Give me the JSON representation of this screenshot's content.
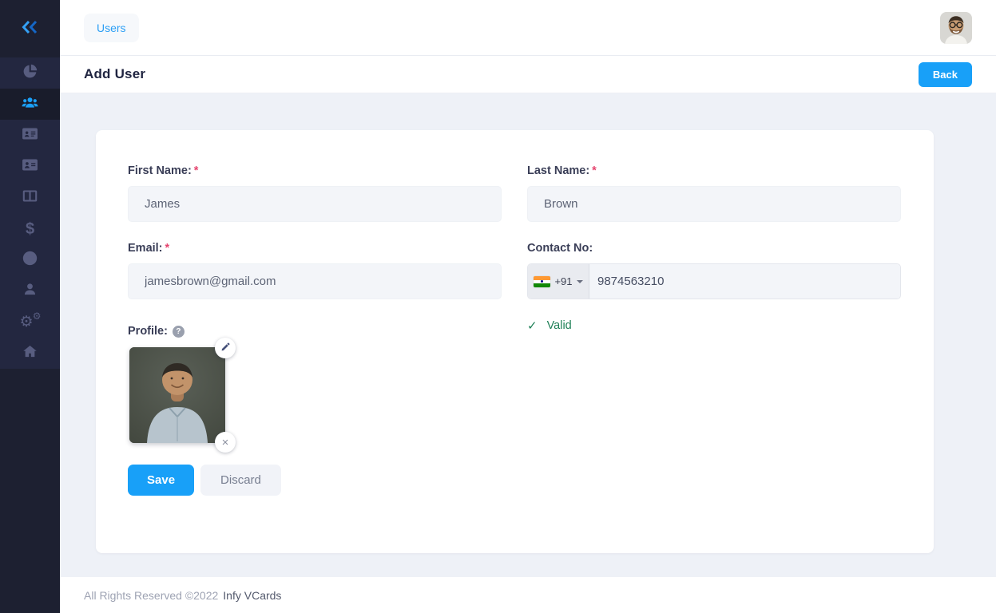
{
  "colors": {
    "accent_blue": "#18a0f8",
    "sidebar_bg": "#1d2031",
    "sidebar_icon": "#585d80",
    "valid_green": "#1f8057",
    "required_red": "#e5456f",
    "content_bg": "#eef1f7"
  },
  "glyphs": {
    "dollar": "$",
    "gear": "⚙",
    "close": "×",
    "question": "?",
    "check": "✓"
  },
  "sidebar": {
    "collapse_icon": "double-chevron-left",
    "items": [
      {
        "icon": "pie-chart",
        "name": "dashboard",
        "active": false
      },
      {
        "icon": "users-group",
        "name": "users",
        "active": true
      },
      {
        "icon": "id-card",
        "name": "vcards",
        "active": false
      },
      {
        "icon": "address-card",
        "name": "contacts",
        "active": false
      },
      {
        "icon": "columns",
        "name": "plans",
        "active": false
      },
      {
        "icon": "dollar-sign",
        "name": "transactions",
        "active": false
      },
      {
        "icon": "globe",
        "name": "languages",
        "active": false
      },
      {
        "icon": "user",
        "name": "account",
        "active": false
      },
      {
        "icon": "gears",
        "name": "settings",
        "active": false
      },
      {
        "icon": "home",
        "name": "home",
        "active": false
      }
    ]
  },
  "topbar": {
    "breadcrumb": "Users",
    "avatar_icon": "user-avatar-photo"
  },
  "header": {
    "title": "Add User",
    "back_label": "Back"
  },
  "form": {
    "required_marker": "*",
    "first_name": {
      "label": "First Name:",
      "value": "James"
    },
    "last_name": {
      "label": "Last Name:",
      "value": "Brown"
    },
    "email": {
      "label": "Email:",
      "value": "jamesbrown@gmail.com"
    },
    "contact": {
      "label": "Contact No:",
      "country": "India",
      "dial_code": "+91",
      "value": "9874563210",
      "validation_text": "Valid"
    },
    "profile": {
      "label": "Profile:",
      "edit_icon": "pencil",
      "remove_icon": "close",
      "help_icon": "question-mark"
    },
    "actions": {
      "save": "Save",
      "discard": "Discard"
    }
  },
  "footer": {
    "rights": "All Rights Reserved ©2022",
    "brand": "Infy VCards"
  }
}
